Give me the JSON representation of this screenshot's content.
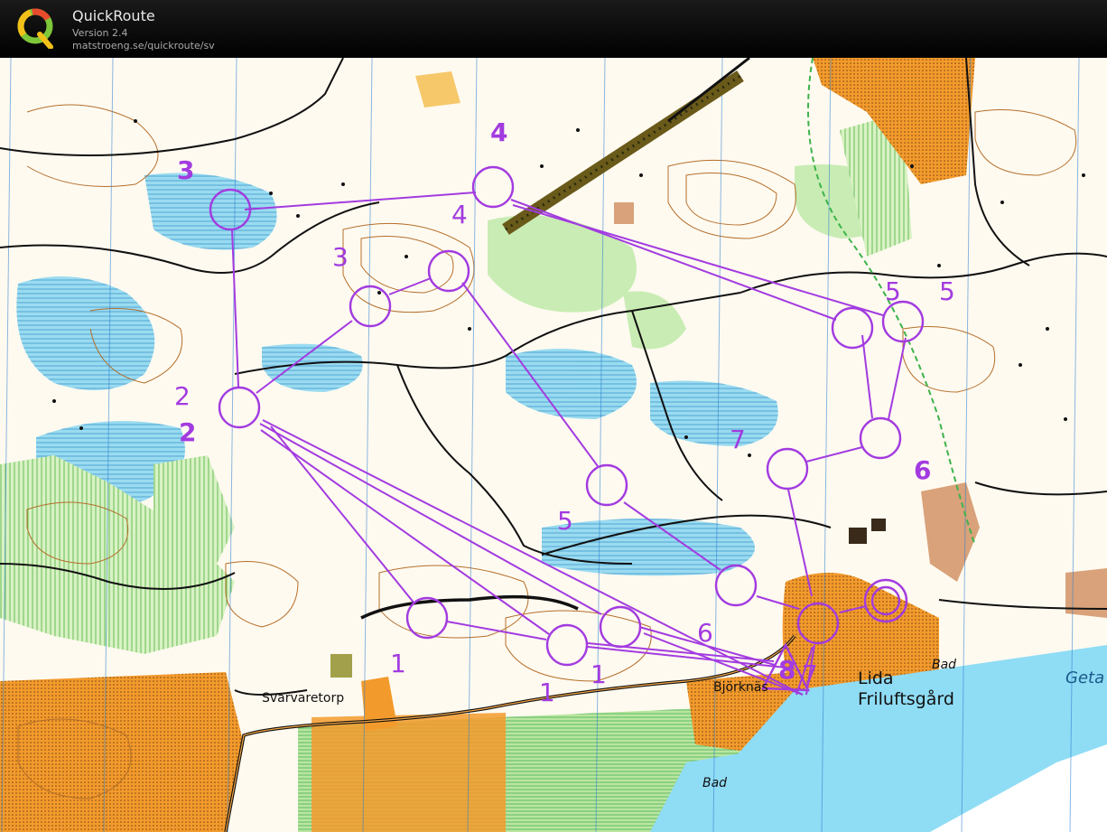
{
  "app": {
    "title": "QuickRoute",
    "version": "Version 2.4",
    "url": "matstroeng.se/quickroute/sv"
  },
  "colors": {
    "course": "#a23be0",
    "water": "#8fd8f0",
    "open": "#f39a2c",
    "forest_green": "#b9e6a0",
    "contour": "#b46e2a"
  },
  "map_labels": {
    "svarvaretorp": "Svarvaretorp",
    "bjorknas": "Björknäs",
    "lida": "Lida",
    "friluftsgard": "Friluftsgård",
    "bad1": "Bad",
    "bad2": "Bad",
    "geta": "Geta"
  },
  "control_numbers": {
    "n3a": "3",
    "n4a": "4",
    "n4b": "4",
    "n3b": "3",
    "n5a": "5",
    "n5b": "5",
    "n2a": "2",
    "n2b": "2",
    "n7a": "7",
    "n6a": "6",
    "n5c": "5",
    "n6b": "6",
    "n1a": "1",
    "n1b": "1",
    "n1c": "1",
    "n8": "8",
    "n7b": "7"
  }
}
